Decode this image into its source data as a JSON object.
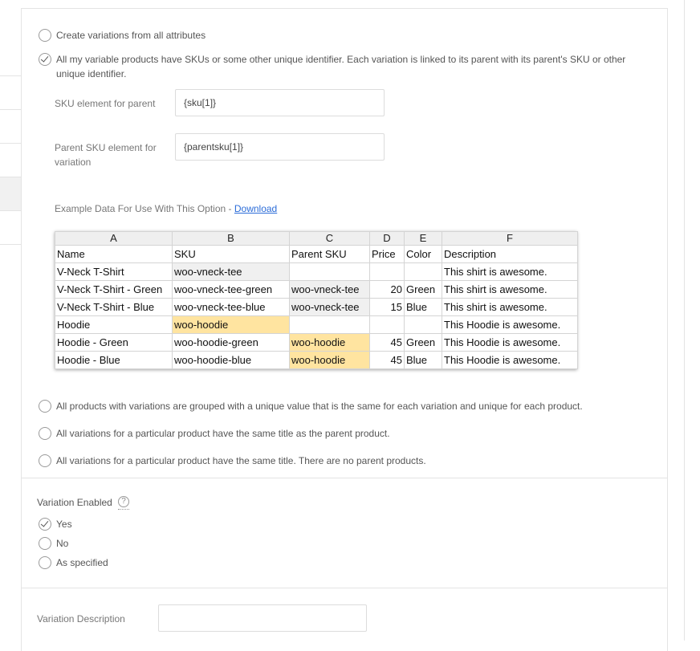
{
  "options": {
    "create_all": "Create variations from all attributes",
    "sku_option_line1": "All my variable products have SKUs or some other unique identifier. Each variation is linked to its parent with its parent's SKU or other",
    "sku_option_line2": "unique identifier.",
    "grouped": "All products with variations are grouped with a unique value that is the same for each variation and unique for each product.",
    "same_title_parent": "All variations for a particular product have the same title as the parent product.",
    "same_title_no_parent": "All variations for a particular product have the same title. There are no parent products."
  },
  "fields": {
    "sku_parent_label": "SKU element for parent",
    "sku_parent_value": "{sku[1]}",
    "parent_sku_label_line1": "Parent SKU element for",
    "parent_sku_label_line2": "variation",
    "parent_sku_value": "{parentsku[1]}"
  },
  "example": {
    "text": "Example Data For Use With This Option - ",
    "download": "Download"
  },
  "sheet": {
    "columns": [
      "A",
      "B",
      "C",
      "D",
      "E",
      "F"
    ],
    "rows": [
      [
        "Name",
        "SKU",
        "Parent SKU",
        "Price",
        "Color",
        "Description"
      ],
      [
        "V-Neck T-Shirt",
        "woo-vneck-tee",
        "",
        "",
        "",
        "This shirt is awesome."
      ],
      [
        "V-Neck T-Shirt - Green",
        "woo-vneck-tee-green",
        "woo-vneck-tee",
        "20",
        "Green",
        "This shirt is awesome."
      ],
      [
        "V-Neck T-Shirt - Blue",
        "woo-vneck-tee-blue",
        "woo-vneck-tee",
        "15",
        "Blue",
        "This shirt is awesome."
      ],
      [
        "Hoodie",
        "woo-hoodie",
        "",
        "",
        "",
        "This Hoodie is awesome."
      ],
      [
        "Hoodie - Green",
        "woo-hoodie-green",
        "woo-hoodie",
        "45",
        "Green",
        "This Hoodie is awesome."
      ],
      [
        "Hoodie - Blue",
        "woo-hoodie-blue",
        "woo-hoodie",
        "45",
        "Blue",
        "This Hoodie is awesome."
      ]
    ],
    "highlight_gray": "#f0f0f0",
    "highlight_yellow": "#ffe4a0"
  },
  "variation_enabled": {
    "label": "Variation Enabled",
    "help_icon": "question-circle-icon",
    "yes": "Yes",
    "no": "No",
    "as_specified": "As specified"
  },
  "variation_description": {
    "label": "Variation Description",
    "value": ""
  },
  "colors": {
    "link": "#2b6cd8",
    "border": "#e4e4e4"
  }
}
